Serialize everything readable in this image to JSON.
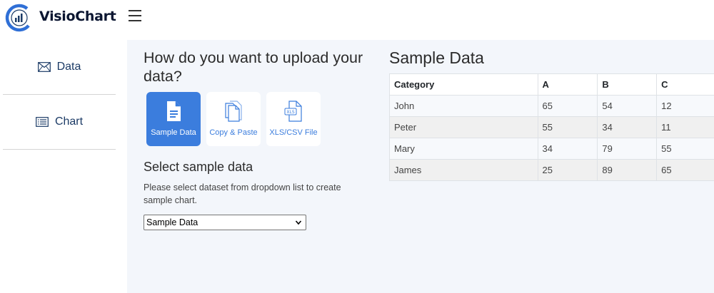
{
  "app": {
    "brand": "VisioChart"
  },
  "sidebar": {
    "items": [
      {
        "label": "Data",
        "icon": "envelope-icon"
      },
      {
        "label": "Chart",
        "icon": "list-icon"
      }
    ]
  },
  "upload": {
    "question": "How do you want to upload your data?",
    "options": [
      {
        "label": "Sample Data",
        "icon": "document-icon",
        "active": true
      },
      {
        "label": "Copy & Paste",
        "icon": "copy-icon",
        "active": false
      },
      {
        "label": "XLS/CSV File",
        "icon": "xls-file-icon",
        "active": false
      }
    ],
    "xls_badge": "XLS"
  },
  "sample_select": {
    "title": "Select sample data",
    "help": "Please select dataset from dropdown list to create sample chart.",
    "selected": "Sample Data"
  },
  "sample_table": {
    "title": "Sample Data",
    "headers": [
      "Category",
      "A",
      "B",
      "C"
    ],
    "rows": [
      [
        "John",
        "65",
        "54",
        "12"
      ],
      [
        "Peter",
        "55",
        "34",
        "11"
      ],
      [
        "Mary",
        "34",
        "79",
        "55"
      ],
      [
        "James",
        "25",
        "89",
        "65"
      ]
    ]
  },
  "colors": {
    "accent": "#3b7ddd",
    "brand_text": "#0b1631",
    "sidebar_text": "#1c3b66",
    "main_bg": "#f3f6fb"
  }
}
